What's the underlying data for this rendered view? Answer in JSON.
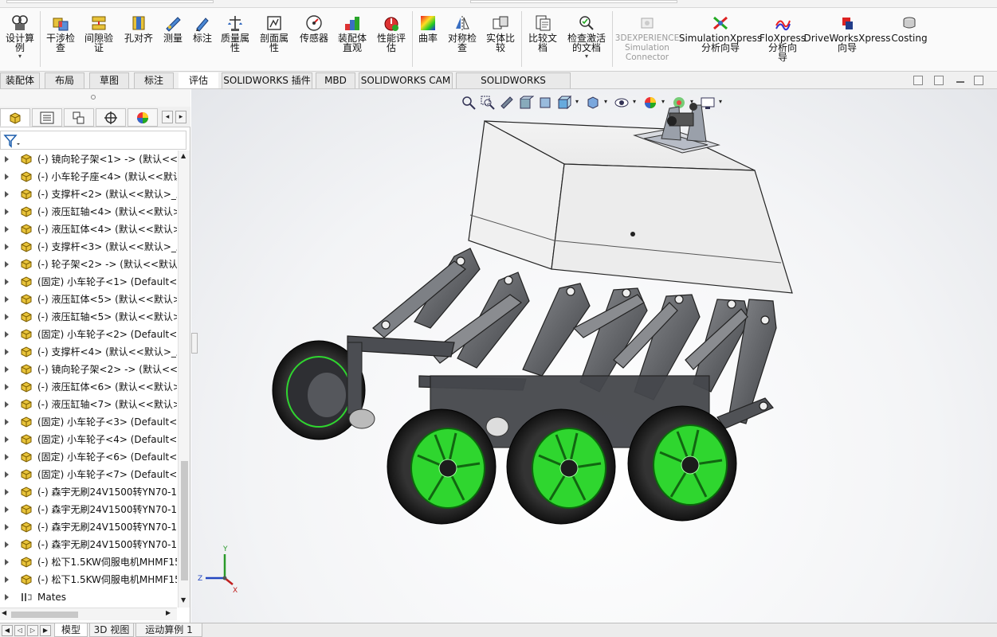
{
  "ribbon": {
    "tools": [
      {
        "id": "design-study",
        "label": "设计算\n例",
        "icon": "design-study-icon",
        "dropdown": true
      },
      {
        "id": "interference",
        "label": "干涉检\n查",
        "icon": "interference-icon"
      },
      {
        "id": "clearance",
        "label": "间隙验\n证",
        "icon": "clearance-icon"
      },
      {
        "id": "hole-align",
        "label": "孔对齐",
        "icon": "hole-align-icon"
      },
      {
        "id": "measure",
        "label": "测量",
        "icon": "measure-icon"
      },
      {
        "id": "markup",
        "label": "标注",
        "icon": "markup-icon"
      },
      {
        "id": "mass-props",
        "label": "质量属\n性",
        "icon": "mass-props-icon"
      },
      {
        "id": "section-props",
        "label": "剖面属\n性",
        "icon": "section-props-icon"
      },
      {
        "id": "sensor",
        "label": "传感器",
        "icon": "sensor-icon"
      },
      {
        "id": "assembly-vis",
        "label": "装配体\n直观",
        "icon": "assembly-vis-icon"
      },
      {
        "id": "performance",
        "label": "性能评\n估",
        "icon": "performance-icon"
      },
      {
        "id": "curvature",
        "label": "曲率",
        "icon": "curvature-icon"
      },
      {
        "id": "symmetry",
        "label": "对称检\n查",
        "icon": "symmetry-icon"
      },
      {
        "id": "compare-solid",
        "label": "实体比\n较",
        "icon": "compare-solid-icon"
      },
      {
        "id": "compare-doc",
        "label": "比较文\n档",
        "icon": "compare-doc-icon"
      },
      {
        "id": "check-active",
        "label": "检查激活\n的文档",
        "icon": "check-active-icon",
        "dropdown": true
      },
      {
        "id": "3dexp",
        "label": "3DEXPERIENCE\nSimulation\nConnector",
        "icon": "3dexp-icon",
        "disabled": true
      },
      {
        "id": "simxpress",
        "label": "SimulationXpress\n分析向导",
        "icon": "simxpress-icon"
      },
      {
        "id": "floxpress",
        "label": "FloXpress\n分析向\n导",
        "icon": "floxpress-icon"
      },
      {
        "id": "driveworks",
        "label": "DriveWorksXpress\n向导",
        "icon": "driveworks-icon"
      },
      {
        "id": "costing",
        "label": "Costing",
        "icon": "costing-icon"
      }
    ]
  },
  "tabs": [
    "装配体",
    "布局",
    "草图",
    "标注",
    "评估",
    "SOLIDWORKS 插件",
    "MBD",
    "SOLIDWORKS CAM",
    "SOLIDWORKS Inspection"
  ],
  "active_tab": "评估",
  "tree": {
    "items": [
      "(-) 镜向轮子架<1> -> (默认<<默",
      "(-) 小车轮子座<4> (默认<<默认",
      "(-) 支撑杆<2> (默认<<默认>_显",
      "(-) 液压缸轴<4> (默认<<默认>_",
      "(-) 液压缸体<4> (默认<<默认>_",
      "(-) 支撑杆<3> (默认<<默认>_显",
      "(-) 轮子架<2> -> (默认<<默认>",
      "(固定) 小车轮子<1> (Default<<",
      "(-) 液压缸体<5> (默认<<默认>_",
      "(-) 液压缸轴<5> (默认<<默认>_",
      "(固定) 小车轮子<2> (Default<<",
      "(-) 支撑杆<4> (默认<<默认>_显",
      "(-) 镜向轮子架<2> -> (默认<<默",
      "(-) 液压缸体<6> (默认<<默认>_",
      "(-) 液压缸轴<7> (默认<<默认>_",
      "(固定) 小车轮子<3> (Default<<",
      "(固定) 小车轮子<4> (Default<<",
      "(固定) 小车轮子<6> (Default<<",
      "(固定) 小车轮子<7> (Default<<",
      "(-) 森宇无刷24V1500转YN70-15",
      "(-) 森宇无刷24V1500转YN70-15",
      "(-) 森宇无刷24V1500转YN70-15",
      "(-) 森宇无刷24V1500转YN70-15",
      "(-) 松下1.5KW伺服电机MHMF15",
      "(-) 松下1.5KW伺服电机MHMF15",
      "Mates"
    ]
  },
  "bottom_tabs": [
    "模型",
    "3D 视图",
    "运动算例 1"
  ],
  "active_bottom_tab": "模型",
  "triad": {
    "x_label": "X",
    "y_label": "Y",
    "z_label": "Z"
  },
  "colors": {
    "accent_green": "#2fd62f",
    "part_gray": "#5a5c60",
    "ribbon_bg": "#fafafa"
  }
}
